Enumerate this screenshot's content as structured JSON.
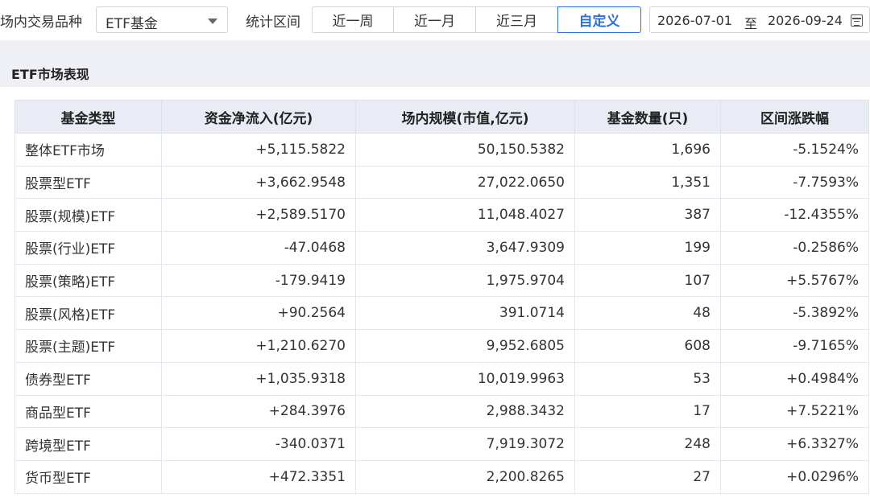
{
  "filters": {
    "market_label": "场内交易品种",
    "market_select_value": "ETF基金",
    "period_label": "统计区间",
    "period_tabs": [
      {
        "label": "近一周",
        "active": false
      },
      {
        "label": "近一月",
        "active": false
      },
      {
        "label": "近三月",
        "active": false
      },
      {
        "label": "自定义",
        "active": true
      }
    ],
    "date_start": "2026-07-01",
    "date_separator": "至",
    "date_end": "2026-09-24"
  },
  "panel": {
    "title": "ETF市场表现"
  },
  "table": {
    "headers": [
      "基金类型",
      "资金净流入(亿元)",
      "场内规模(市值,亿元)",
      "基金数量(只)",
      "区间涨跌幅"
    ],
    "rows": [
      {
        "type": "整体ETF市场",
        "net_inflow": "+5,115.5822",
        "scale": "50,150.5382",
        "count": "1,696",
        "change": "-5.1524%"
      },
      {
        "type": "股票型ETF",
        "net_inflow": "+3,662.9548",
        "scale": "27,022.0650",
        "count": "1,351",
        "change": "-7.7593%"
      },
      {
        "type": "股票(规模)ETF",
        "net_inflow": "+2,589.5170",
        "scale": "11,048.4027",
        "count": "387",
        "change": "-12.4355%"
      },
      {
        "type": "股票(行业)ETF",
        "net_inflow": "-47.0468",
        "scale": "3,647.9309",
        "count": "199",
        "change": "-0.2586%"
      },
      {
        "type": "股票(策略)ETF",
        "net_inflow": "-179.9419",
        "scale": "1,975.9704",
        "count": "107",
        "change": "+5.5767%"
      },
      {
        "type": "股票(风格)ETF",
        "net_inflow": "+90.2564",
        "scale": "391.0714",
        "count": "48",
        "change": "-5.3892%"
      },
      {
        "type": "股票(主题)ETF",
        "net_inflow": "+1,210.6270",
        "scale": "9,952.6805",
        "count": "608",
        "change": "-9.7165%"
      },
      {
        "type": "债券型ETF",
        "net_inflow": "+1,035.9318",
        "scale": "10,019.9963",
        "count": "53",
        "change": "+0.4984%"
      },
      {
        "type": "商品型ETF",
        "net_inflow": "+284.3976",
        "scale": "2,988.3432",
        "count": "17",
        "change": "+7.5221%"
      },
      {
        "type": "跨境型ETF",
        "net_inflow": "-340.0371",
        "scale": "7,919.3072",
        "count": "248",
        "change": "+6.3327%"
      },
      {
        "type": "货币型ETF",
        "net_inflow": "+472.3351",
        "scale": "2,200.8265",
        "count": "27",
        "change": "+0.0296%"
      }
    ]
  },
  "colors": {
    "positive": "#e5261c",
    "negative": "#1f9a3f",
    "accent": "#2f6fdc",
    "header_bg": "#e9ecf5"
  }
}
